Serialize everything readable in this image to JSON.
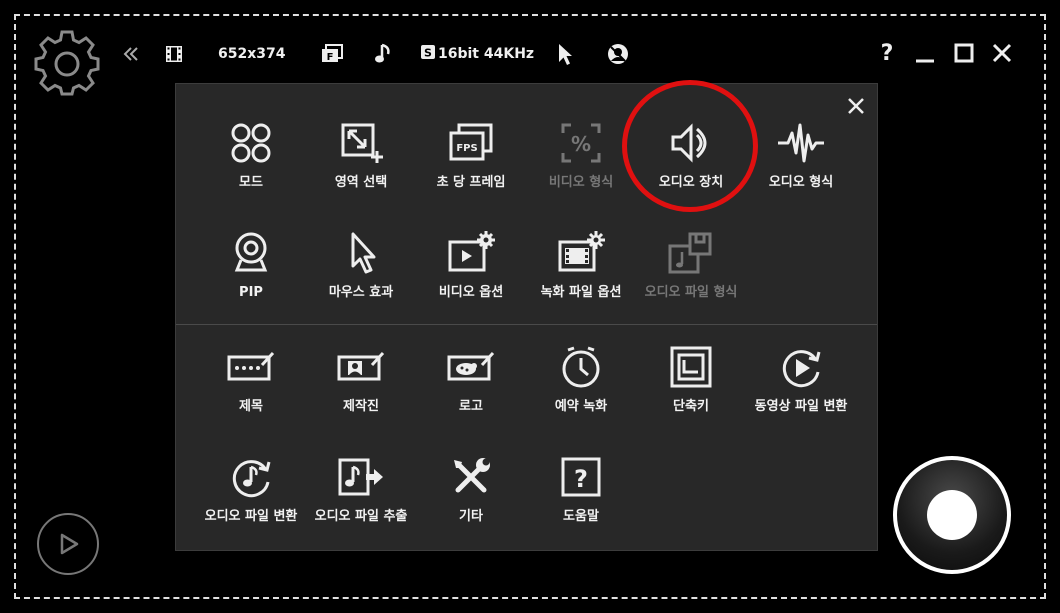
{
  "toolbar": {
    "resolution": "652x374",
    "audio_format": "16bit 44KHz",
    "help": "?"
  },
  "panel": {
    "row1": [
      {
        "label": "모드",
        "icon": "mode-icon"
      },
      {
        "label": "영역 선택",
        "icon": "area-select-icon"
      },
      {
        "label": "초 당 프레임",
        "icon": "fps-icon",
        "icon_text": "FPS"
      },
      {
        "label": "비디오 형식",
        "icon": "video-format-icon",
        "disabled": true
      },
      {
        "label": "오디오 장치",
        "icon": "audio-device-icon",
        "highlighted": true
      },
      {
        "label": "오디오 형식",
        "icon": "audio-format-icon"
      }
    ],
    "row2": [
      {
        "label": "PIP",
        "icon": "webcam-icon"
      },
      {
        "label": "마우스 효과",
        "icon": "mouse-effect-icon"
      },
      {
        "label": "비디오 옵션",
        "icon": "video-options-icon"
      },
      {
        "label": "녹화 파일 옵션",
        "icon": "record-file-options-icon"
      },
      {
        "label": "오디오 파일 형식",
        "icon": "audio-file-format-icon",
        "disabled": true
      }
    ],
    "row3": [
      {
        "label": "제목",
        "icon": "title-icon"
      },
      {
        "label": "제작진",
        "icon": "credits-icon"
      },
      {
        "label": "로고",
        "icon": "logo-icon"
      },
      {
        "label": "예약 녹화",
        "icon": "schedule-record-icon"
      },
      {
        "label": "단축키",
        "icon": "hotkey-icon"
      },
      {
        "label": "동영상 파일 변환",
        "icon": "video-convert-icon"
      }
    ],
    "row4": [
      {
        "label": "오디오 파일 변환",
        "icon": "audio-convert-icon"
      },
      {
        "label": "오디오 파일 추출",
        "icon": "audio-extract-icon"
      },
      {
        "label": "기타",
        "icon": "tools-icon"
      },
      {
        "label": "도움말",
        "icon": "help-icon",
        "icon_text": "?"
      }
    ]
  },
  "colors": {
    "background": "#000000",
    "panel": "#282828",
    "highlight": "#e01010",
    "text": "#f2f2f2",
    "disabled": "#777777"
  }
}
